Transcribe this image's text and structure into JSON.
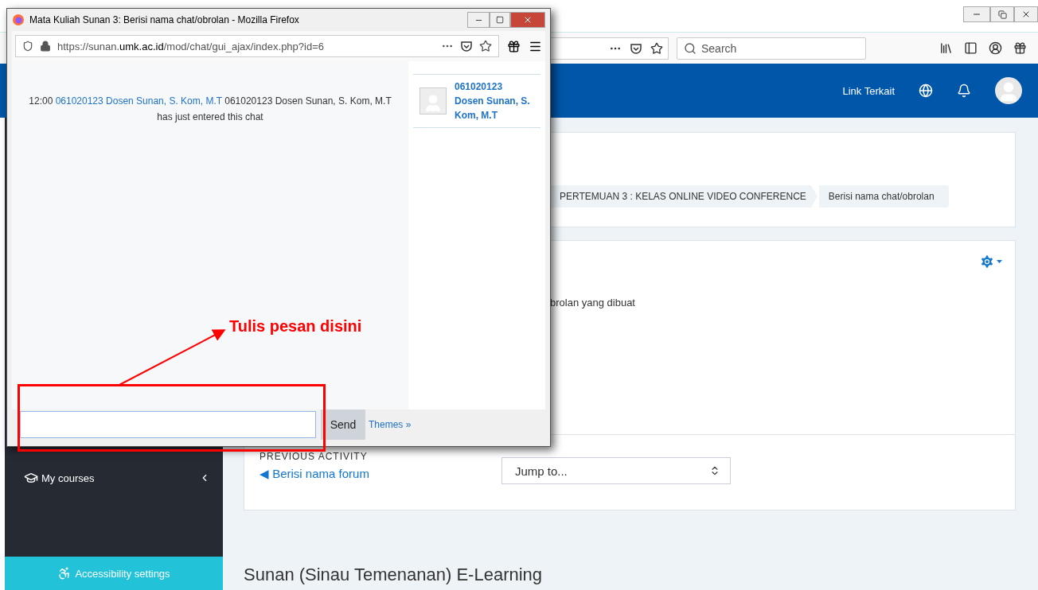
{
  "popup": {
    "title": "Mata Kuliah Sunan 3: Berisi nama chat/obrolan - Mozilla Firefox",
    "url_prefix": "https://sunan.",
    "url_domain": "umk.ac.id",
    "url_path": "/mod/chat/gui_ajax/index.php?id=6",
    "messages": [
      {
        "time": "12:00",
        "user": "061020123 Dosen Sunan, S. Kom, M.T",
        "text": "061020123 Dosen Sunan, S. Kom, M.T has just entered this chat"
      }
    ],
    "users": [
      {
        "name": "061020123 Dosen Sunan, S. Kom, M.T"
      }
    ],
    "send_button": "Send",
    "themes_link": "Themes »"
  },
  "browser": {
    "search": {
      "placeholder": "Search"
    }
  },
  "navbar": {
    "link": "Link Terkait"
  },
  "sidebar": {
    "items": [
      {
        "label": "My courses"
      }
    ],
    "accessibility": "Accessibility settings"
  },
  "breadcrumb": [
    "PERTEMUAN 3 : KELAS ONLINE VIDEO CONFERENCE",
    "Berisi nama chat/obrolan"
  ],
  "description": "brolan yang dibuat",
  "navigation": {
    "previous_label": "PREVIOUS ACTIVITY",
    "previous_link": "◀ Berisi nama forum",
    "jump_select": "Jump to..."
  },
  "footer_title": "Sunan (Sinau Temenanan) E-Learning",
  "annotation": {
    "text": "Tulis pesan disini"
  }
}
